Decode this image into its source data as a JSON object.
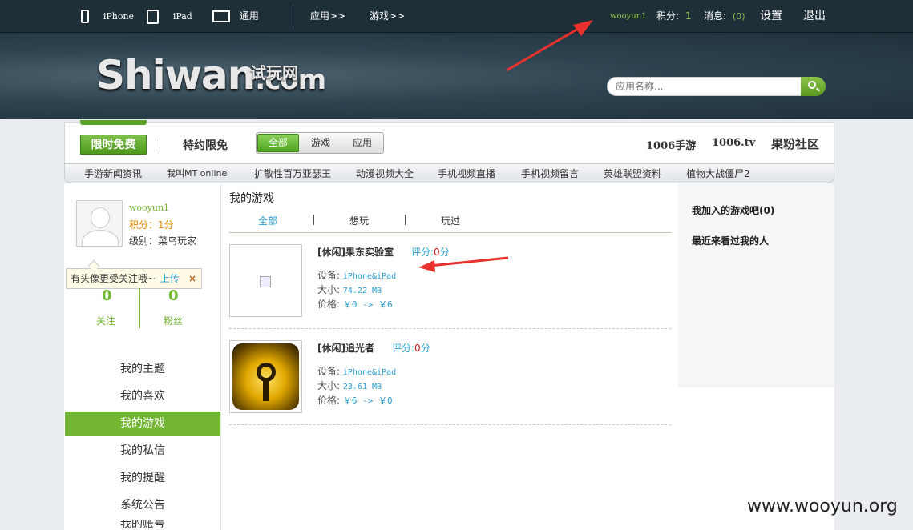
{
  "topbar": {
    "iphone": "iPhone",
    "ipad": "iPad",
    "general": "通用",
    "apps": "应用>>",
    "games": "游戏>>",
    "username": "wooyun1",
    "points_label": "积分:",
    "points_value": "1",
    "messages_label": "消息:",
    "messages_value": "(0)",
    "settings": "设置",
    "logout": "退出"
  },
  "header": {
    "logo_main": "Shiwan",
    "logo_com": ".com",
    "logo_cn": "试玩网",
    "search_placeholder": "应用名称..."
  },
  "nav": {
    "limited_free": "限时免费",
    "special": "特约限免",
    "seg": [
      "全部",
      "游戏",
      "应用"
    ],
    "right_links": [
      "1006手游",
      "1006.tv",
      "果粉社区"
    ]
  },
  "subnav": [
    "手游新闻资讯",
    "我叫MT online",
    "扩散性百万亚瑟王",
    "动漫视频大全",
    "手机视频直播",
    "手机视频留言",
    "英雄联盟资料",
    "植物大战僵尸2"
  ],
  "profile": {
    "name": "wooyun1",
    "points": "积分：1分",
    "level": "级别：菜鸟玩家",
    "tip_text": "有头像更受关注哦~",
    "tip_upload": "上传",
    "tip_close": "×",
    "follow_count": "0",
    "follow_label": "关注",
    "fans_count": "0",
    "fans_label": "粉丝"
  },
  "menu": [
    "我的主题",
    "我的喜欢",
    "我的游戏",
    "我的私信",
    "我的提醒",
    "系统公告",
    "我的账号"
  ],
  "main": {
    "title": "我的游戏",
    "tabs": [
      "全部",
      "想玩",
      "玩过"
    ],
    "games": [
      {
        "name": "[休闲]果东实验室",
        "score_label": "评分:",
        "score_value": "0",
        "score_unit": "分",
        "device_label": "设备:",
        "device": "iPhone&iPad",
        "size_label": "大小:",
        "size": "74.22 MB",
        "price_label": "价格:",
        "price": "￥0 -> ￥6"
      },
      {
        "name": "[休闲]追光者",
        "score_label": "评分:",
        "score_value": "0",
        "score_unit": "分",
        "device_label": "设备:",
        "device": "iPhone&iPad",
        "size_label": "大小:",
        "size": "23.61 MB",
        "price_label": "价格:",
        "price": "￥6 -> ￥0"
      }
    ]
  },
  "right": {
    "joined": "我加入的游戏吧(0)",
    "visitors": "最近来看过我的人"
  },
  "watermark": "www.wooyun.org",
  "colors": {
    "accent_green": "#73b632",
    "link_blue": "#2a9fcf",
    "score_red": "#d01414"
  }
}
